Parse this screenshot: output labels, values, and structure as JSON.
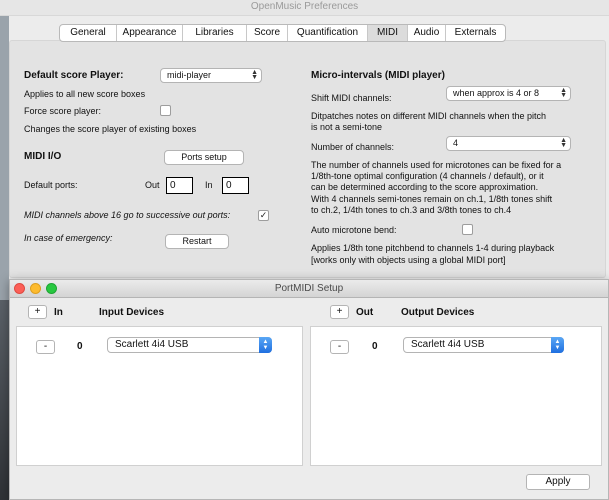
{
  "main_window": {
    "title": "OpenMusic Preferences",
    "tabs": [
      "General",
      "Appearance",
      "Libraries",
      "Score",
      "Quantification",
      "MIDI",
      "Audio",
      "Externals"
    ],
    "active_tab": "MIDI"
  },
  "left": {
    "default_score_player": {
      "heading": "Default score Player:",
      "value": "midi-player",
      "applies_note": "Applies to all new score boxes",
      "force_label": "Force score player:",
      "force_checked": false,
      "changes_note": "Changes the score player of existing boxes"
    },
    "midi_io": {
      "heading": "MIDI I/O",
      "ports_setup_label": "Ports setup",
      "default_ports_label": "Default ports:",
      "out_label": "Out",
      "out_value": "0",
      "in_label": "In",
      "in_value": "0",
      "above16_label": "MIDI channels above 16 go to successive out ports:",
      "above16_checked": true,
      "emergency_label": "In case of emergency:",
      "restart_label": "Restart"
    }
  },
  "right": {
    "heading": "Micro-intervals (MIDI player)",
    "shift_label": "Shift MIDI channels:",
    "shift_value": "when approx is 4 or 8",
    "dispatch_note_1": "Ditpatches notes on different MIDI channels when the pitch",
    "dispatch_note_2": "is not a semi-tone",
    "num_channels_label": "Number of channels:",
    "num_channels_value": "4",
    "desc1_line1": "The number of channels used for microtones can be fixed for a",
    "desc1_line2": "1/8th-tone optimal configuration (4 channels / default), or it",
    "desc1_line3": "can be determined according to the score approximation.",
    "desc2_line1": "With 4 channels  semi-tones remain on ch.1, 1/8th tones shift",
    "desc2_line2": "to ch.2, 1/4th tones to ch.3 and 3/8th tones to ch.4",
    "auto_bend_label": "Auto microtone bend:",
    "auto_bend_checked": false,
    "pitchbend_note_1": "Applies 1/8th tone pitchbend to channels 1-4 during playback",
    "pitchbend_note_2": "[works only with objects using a global MIDI port]"
  },
  "portmidi": {
    "title": "PortMIDI Setup",
    "input": {
      "add_label": "+",
      "dir_label": "In",
      "header": "Input Devices",
      "remove_label": "-",
      "port": "0",
      "device": "Scarlett 4i4 USB"
    },
    "output": {
      "add_label": "+",
      "dir_label": "Out",
      "header": "Output Devices",
      "remove_label": "-",
      "port": "0",
      "device": "Scarlett 4i4 USB"
    },
    "apply_label": "Apply"
  },
  "colors": {
    "close": "#fc5f57",
    "minimize": "#fdbb2e",
    "zoom": "#28c840",
    "accent_blue": "#1f6fe0"
  }
}
